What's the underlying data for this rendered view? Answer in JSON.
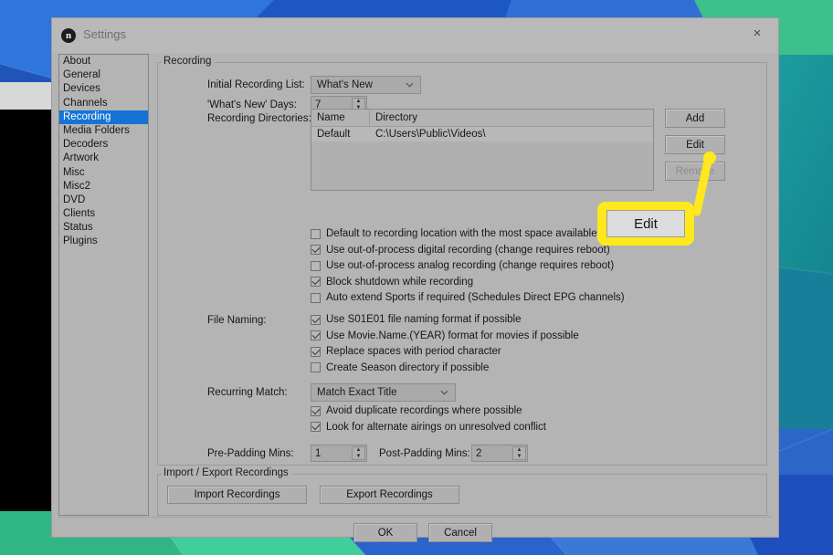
{
  "window": {
    "title": "Settings",
    "icon": "n",
    "close_label": "×"
  },
  "sidebar": {
    "items": [
      {
        "label": "About",
        "selected": false
      },
      {
        "label": "General",
        "selected": false
      },
      {
        "label": "Devices",
        "selected": false
      },
      {
        "label": "Channels",
        "selected": false
      },
      {
        "label": "Recording",
        "selected": true
      },
      {
        "label": "Media Folders",
        "selected": false
      },
      {
        "label": "Decoders",
        "selected": false
      },
      {
        "label": "Artwork",
        "selected": false
      },
      {
        "label": "Misc",
        "selected": false
      },
      {
        "label": "Misc2",
        "selected": false
      },
      {
        "label": "DVD",
        "selected": false
      },
      {
        "label": "Clients",
        "selected": false
      },
      {
        "label": "Status",
        "selected": false
      },
      {
        "label": "Plugins",
        "selected": false
      }
    ]
  },
  "recording": {
    "group_title": "Recording",
    "initial_list_label": "Initial Recording List:",
    "initial_list_value": "What's New",
    "whats_new_days_label": "'What's New' Days:",
    "whats_new_days_value": "7",
    "directories_label": "Recording Directories:",
    "table": {
      "columns": [
        "Name",
        "Directory"
      ],
      "rows": [
        {
          "name": "Default",
          "directory": "C:\\Users\\Public\\Videos\\"
        }
      ]
    },
    "buttons": {
      "add": "Add",
      "edit": "Edit",
      "remove": "Remove"
    },
    "options": [
      {
        "label": "Default to recording location with the most space available",
        "checked": false
      },
      {
        "label": "Use out-of-process digital recording (change requires reboot)",
        "checked": true
      },
      {
        "label": "Use out-of-process analog recording (change requires reboot)",
        "checked": false
      },
      {
        "label": "Block shutdown while recording",
        "checked": true
      },
      {
        "label": "Auto extend Sports if required (Schedules Direct EPG channels)",
        "checked": false
      }
    ],
    "file_naming_label": "File Naming:",
    "file_naming": [
      {
        "label": "Use S01E01 file naming format if possible",
        "checked": true
      },
      {
        "label": "Use Movie.Name.(YEAR) format for movies if possible",
        "checked": true
      },
      {
        "label": "Replace spaces with period character",
        "checked": true
      },
      {
        "label": "Create Season directory if possible",
        "checked": false
      }
    ],
    "recurring_match_label": "Recurring Match:",
    "recurring_match_value": "Match Exact Title",
    "recurring_options": [
      {
        "label": "Avoid duplicate recordings where possible",
        "checked": true
      },
      {
        "label": "Look for alternate airings on unresolved conflict",
        "checked": true
      }
    ],
    "pre_padding_label": "Pre-Padding Mins:",
    "pre_padding_value": "1",
    "post_padding_label": "Post-Padding Mins:",
    "post_padding_value": "2"
  },
  "import_export": {
    "group_title": "Import / Export Recordings",
    "import_label": "Import Recordings",
    "export_label": "Export Recordings"
  },
  "footer": {
    "ok": "OK",
    "cancel": "Cancel"
  },
  "callout": {
    "label": "Edit",
    "highlight_color": "#ffe81c"
  }
}
